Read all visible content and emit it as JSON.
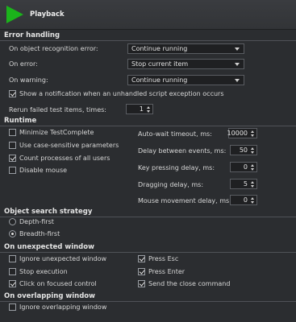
{
  "header": {
    "title": "Playback",
    "icon": "play-icon",
    "accent": "#1bb31b"
  },
  "sections": {
    "error_handling": "Error handling",
    "runtime": "Runtime",
    "object_search": "Object search strategy",
    "unexpected_window": "On unexpected window",
    "overlapping_window": "On overlapping window"
  },
  "error_handling": {
    "recognition_label": "On object recognition error:",
    "recognition_value": "Continue running",
    "error_label": "On error:",
    "error_value": "Stop current item",
    "warning_label": "On warning:",
    "warning_value": "Continue running",
    "notify_label": "Show a notification when an unhandled script exception occurs",
    "notify_checked": true,
    "rerun_label": "Rerun failed test items, times:",
    "rerun_value": "1"
  },
  "runtime": {
    "minimize_label": "Minimize TestComplete",
    "minimize_checked": false,
    "case_label": "Use case-sensitive parameters",
    "case_checked": false,
    "count_label": "Count processes of all users",
    "count_checked": true,
    "disable_mouse_label": "Disable mouse",
    "disable_mouse_checked": false,
    "autowait_label": "Auto-wait timeout, ms:",
    "autowait_value": "10000",
    "delay_label": "Delay between events, ms:",
    "delay_value": "50",
    "key_label": "Key pressing delay, ms:",
    "key_value": "0",
    "drag_label": "Dragging delay, ms:",
    "drag_value": "5",
    "mouse_move_label": "Mouse movement delay, ms:",
    "mouse_move_value": "0"
  },
  "object_search": {
    "depth_label": "Depth-first",
    "depth_checked": false,
    "breadth_label": "Breadth-first",
    "breadth_checked": true
  },
  "unexpected_window": {
    "ignore_label": "Ignore unexpected window",
    "ignore_checked": false,
    "stop_label": "Stop execution",
    "stop_checked": false,
    "click_label": "Click on focused control",
    "click_checked": true,
    "esc_label": "Press Esc",
    "esc_checked": true,
    "enter_label": "Press Enter",
    "enter_checked": true,
    "close_label": "Send the close command",
    "close_checked": true
  },
  "overlapping_window": {
    "ignore_label": "Ignore overlapping window",
    "ignore_checked": false
  }
}
